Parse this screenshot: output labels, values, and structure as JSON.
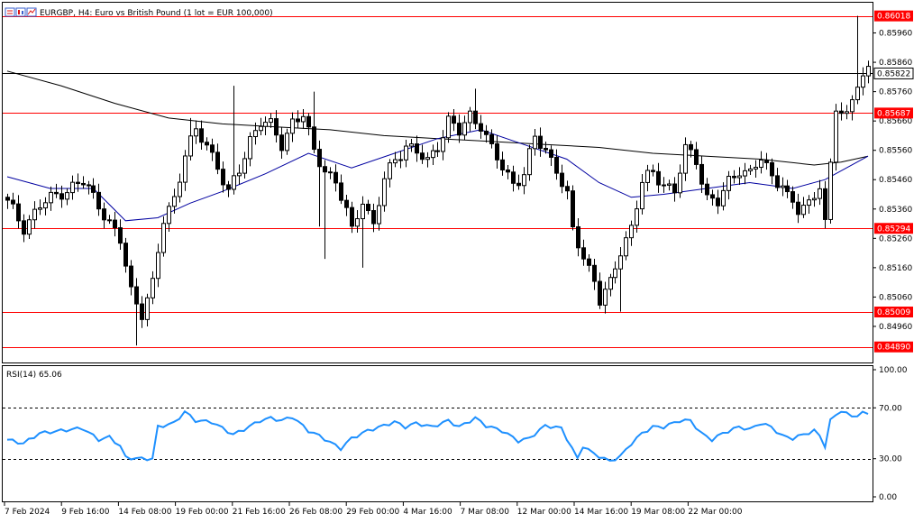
{
  "header": {
    "symbol_info": "EURGBP, H4:  Euro vs British Pound (1 lot = EUR 100,000)"
  },
  "rsi_panel": {
    "label": "RSI(14) 65.06"
  },
  "colors": {
    "background": "#ffffff",
    "candle": "#000000",
    "level_line": "#ff0000",
    "level_tag_bg": "#ff0000",
    "level_tag_text": "#ffffff",
    "current_price_line": "#000000",
    "ma_slow": "#000000",
    "ma_fast": "#0000a0",
    "rsi_line": "#1e90ff",
    "grid_dash": "#000000"
  },
  "icons": [
    "chart-bars-icon",
    "chart-candles-icon",
    "chart-line-icon"
  ],
  "chart_data": [
    {
      "type": "candlestick",
      "title": "EURGBP, H4:  Euro vs British Pound (1 lot = EUR 100,000)",
      "ylim": [
        0.8484,
        0.8606
      ],
      "y_ticks": [
        "0.85960",
        "0.85860",
        "0.85760",
        "0.85660",
        "0.85560",
        "0.85460",
        "0.85360",
        "0.85260",
        "0.85160",
        "0.85060",
        "0.84960"
      ],
      "x_ticks": [
        "7 Feb 2024",
        "9 Feb 16:00",
        "14 Feb 08:00",
        "19 Feb 00:00",
        "21 Feb 16:00",
        "26 Feb 08:00",
        "29 Feb 00:00",
        "4 Mar 16:00",
        "7 Mar 08:00",
        "12 Mar 00:00",
        "14 Mar 16:00",
        "19 Mar 08:00",
        "22 Mar 00:00"
      ],
      "levels": [
        {
          "value": 0.86018,
          "label": "0.86018"
        },
        {
          "value": 0.85687,
          "label": "0.85687"
        },
        {
          "value": 0.85294,
          "label": "0.85294"
        },
        {
          "value": 0.85009,
          "label": "0.85009"
        },
        {
          "value": 0.8489,
          "label": "0.84890"
        }
      ],
      "current_price": {
        "value": 0.85822,
        "label": "0.85822"
      },
      "trend": [
        {
          "i": 0,
          "p": 0.8538
        },
        {
          "i": 3,
          "p": 0.853
        },
        {
          "i": 6,
          "p": 0.8537
        },
        {
          "i": 10,
          "p": 0.8542
        },
        {
          "i": 14,
          "p": 0.8545
        },
        {
          "i": 17,
          "p": 0.8538
        },
        {
          "i": 19,
          "p": 0.8531
        },
        {
          "i": 21,
          "p": 0.8525
        },
        {
          "i": 23,
          "p": 0.8508
        },
        {
          "i": 25,
          "p": 0.8501
        },
        {
          "i": 27,
          "p": 0.851
        },
        {
          "i": 29,
          "p": 0.8532
        },
        {
          "i": 31,
          "p": 0.854
        },
        {
          "i": 33,
          "p": 0.8555
        },
        {
          "i": 35,
          "p": 0.8562
        },
        {
          "i": 37,
          "p": 0.8558
        },
        {
          "i": 39,
          "p": 0.8551
        },
        {
          "i": 41,
          "p": 0.8541
        },
        {
          "i": 43,
          "p": 0.8549
        },
        {
          "i": 45,
          "p": 0.856
        },
        {
          "i": 47,
          "p": 0.8566
        },
        {
          "i": 49,
          "p": 0.8564
        },
        {
          "i": 51,
          "p": 0.8558
        },
        {
          "i": 53,
          "p": 0.8566
        },
        {
          "i": 55,
          "p": 0.8568
        },
        {
          "i": 57,
          "p": 0.8555
        },
        {
          "i": 59,
          "p": 0.855
        },
        {
          "i": 61,
          "p": 0.8545
        },
        {
          "i": 63,
          "p": 0.8535
        },
        {
          "i": 64,
          "p": 0.8528
        },
        {
          "i": 66,
          "p": 0.854
        },
        {
          "i": 68,
          "p": 0.853
        },
        {
          "i": 70,
          "p": 0.8546
        },
        {
          "i": 72,
          "p": 0.8553
        },
        {
          "i": 74,
          "p": 0.8558
        },
        {
          "i": 76,
          "p": 0.8555
        },
        {
          "i": 78,
          "p": 0.8552
        },
        {
          "i": 80,
          "p": 0.8558
        },
        {
          "i": 82,
          "p": 0.8566
        },
        {
          "i": 84,
          "p": 0.8562
        },
        {
          "i": 86,
          "p": 0.8568
        },
        {
          "i": 88,
          "p": 0.8565
        },
        {
          "i": 90,
          "p": 0.8556
        },
        {
          "i": 92,
          "p": 0.855
        },
        {
          "i": 94,
          "p": 0.8545
        },
        {
          "i": 96,
          "p": 0.8548
        },
        {
          "i": 98,
          "p": 0.856
        },
        {
          "i": 100,
          "p": 0.8556
        },
        {
          "i": 102,
          "p": 0.855
        },
        {
          "i": 104,
          "p": 0.854
        },
        {
          "i": 105,
          "p": 0.8528
        },
        {
          "i": 107,
          "p": 0.852
        },
        {
          "i": 109,
          "p": 0.8512
        },
        {
          "i": 110,
          "p": 0.8505
        },
        {
          "i": 112,
          "p": 0.851
        },
        {
          "i": 114,
          "p": 0.8522
        },
        {
          "i": 116,
          "p": 0.853
        },
        {
          "i": 118,
          "p": 0.8545
        },
        {
          "i": 120,
          "p": 0.8548
        },
        {
          "i": 122,
          "p": 0.8545
        },
        {
          "i": 124,
          "p": 0.8542
        },
        {
          "i": 126,
          "p": 0.8556
        },
        {
          "i": 128,
          "p": 0.8553
        },
        {
          "i": 130,
          "p": 0.854
        },
        {
          "i": 132,
          "p": 0.8538
        },
        {
          "i": 134,
          "p": 0.8545
        },
        {
          "i": 136,
          "p": 0.855
        },
        {
          "i": 138,
          "p": 0.8548
        },
        {
          "i": 140,
          "p": 0.8553
        },
        {
          "i": 142,
          "p": 0.8547
        },
        {
          "i": 144,
          "p": 0.8545
        },
        {
          "i": 145,
          "p": 0.854
        },
        {
          "i": 147,
          "p": 0.8535
        },
        {
          "i": 149,
          "p": 0.8538
        },
        {
          "i": 151,
          "p": 0.8545
        },
        {
          "i": 152,
          "p": 0.8531
        },
        {
          "i": 153,
          "p": 0.855
        },
        {
          "i": 154,
          "p": 0.857
        },
        {
          "i": 156,
          "p": 0.8568
        },
        {
          "i": 158,
          "p": 0.858
        },
        {
          "i": 160,
          "p": 0.8582
        }
      ],
      "spikes": [
        {
          "i": 24,
          "p": 0.84895
        },
        {
          "i": 34,
          "p": 0.8567
        },
        {
          "i": 42,
          "p": 0.8578
        },
        {
          "i": 57,
          "p": 0.8576
        },
        {
          "i": 58,
          "p": 0.853
        },
        {
          "i": 59,
          "p": 0.8519
        },
        {
          "i": 66,
          "p": 0.8516
        },
        {
          "i": 87,
          "p": 0.8577
        },
        {
          "i": 114,
          "p": 0.8501
        },
        {
          "i": 152,
          "p": 0.85294
        },
        {
          "i": 158,
          "p": 0.86018
        }
      ],
      "ma_slow": [
        {
          "i": 0,
          "p": 0.8583
        },
        {
          "i": 10,
          "p": 0.8578
        },
        {
          "i": 20,
          "p": 0.8572
        },
        {
          "i": 30,
          "p": 0.8567
        },
        {
          "i": 40,
          "p": 0.8565
        },
        {
          "i": 50,
          "p": 0.8564
        },
        {
          "i": 60,
          "p": 0.8563
        },
        {
          "i": 70,
          "p": 0.8561
        },
        {
          "i": 80,
          "p": 0.856
        },
        {
          "i": 90,
          "p": 0.8559
        },
        {
          "i": 100,
          "p": 0.8558
        },
        {
          "i": 110,
          "p": 0.8557
        },
        {
          "i": 120,
          "p": 0.8555
        },
        {
          "i": 130,
          "p": 0.8554
        },
        {
          "i": 140,
          "p": 0.8553
        },
        {
          "i": 150,
          "p": 0.8551
        },
        {
          "i": 155,
          "p": 0.8552
        },
        {
          "i": 160,
          "p": 0.8554
        }
      ],
      "ma_fast": [
        {
          "i": 0,
          "p": 0.8547
        },
        {
          "i": 8,
          "p": 0.8543
        },
        {
          "i": 16,
          "p": 0.8543
        },
        {
          "i": 22,
          "p": 0.8532
        },
        {
          "i": 28,
          "p": 0.8533
        },
        {
          "i": 34,
          "p": 0.8538
        },
        {
          "i": 40,
          "p": 0.8542
        },
        {
          "i": 48,
          "p": 0.8548
        },
        {
          "i": 56,
          "p": 0.8555
        },
        {
          "i": 64,
          "p": 0.855
        },
        {
          "i": 72,
          "p": 0.8555
        },
        {
          "i": 80,
          "p": 0.856
        },
        {
          "i": 88,
          "p": 0.8563
        },
        {
          "i": 96,
          "p": 0.8558
        },
        {
          "i": 104,
          "p": 0.8553
        },
        {
          "i": 110,
          "p": 0.8545
        },
        {
          "i": 116,
          "p": 0.854
        },
        {
          "i": 122,
          "p": 0.8541
        },
        {
          "i": 130,
          "p": 0.8543
        },
        {
          "i": 138,
          "p": 0.8545
        },
        {
          "i": 146,
          "p": 0.8543
        },
        {
          "i": 152,
          "p": 0.8546
        },
        {
          "i": 156,
          "p": 0.855
        },
        {
          "i": 160,
          "p": 0.8554
        }
      ]
    },
    {
      "type": "line",
      "title": "RSI(14) 65.06",
      "ylim": [
        0,
        100
      ],
      "y_ticks": [
        "100.00",
        "70.00",
        "30.00",
        "0.00"
      ],
      "dashed_levels": [
        70,
        30
      ],
      "series": [
        {
          "values": [
            {
              "i": 0,
              "v": 45
            },
            {
              "i": 3,
              "v": 42
            },
            {
              "i": 6,
              "v": 50
            },
            {
              "i": 10,
              "v": 52
            },
            {
              "i": 14,
              "v": 54
            },
            {
              "i": 17,
              "v": 45
            },
            {
              "i": 19,
              "v": 47
            },
            {
              "i": 21,
              "v": 40
            },
            {
              "i": 22,
              "v": 31
            },
            {
              "i": 25,
              "v": 30
            },
            {
              "i": 27,
              "v": 30
            },
            {
              "i": 28,
              "v": 55
            },
            {
              "i": 31,
              "v": 58
            },
            {
              "i": 33,
              "v": 67
            },
            {
              "i": 35,
              "v": 60
            },
            {
              "i": 38,
              "v": 59
            },
            {
              "i": 42,
              "v": 49
            },
            {
              "i": 44,
              "v": 53
            },
            {
              "i": 47,
              "v": 60
            },
            {
              "i": 49,
              "v": 62
            },
            {
              "i": 51,
              "v": 60
            },
            {
              "i": 53,
              "v": 63
            },
            {
              "i": 56,
              "v": 52
            },
            {
              "i": 58,
              "v": 48
            },
            {
              "i": 60,
              "v": 43
            },
            {
              "i": 62,
              "v": 38
            },
            {
              "i": 64,
              "v": 46
            },
            {
              "i": 67,
              "v": 52
            },
            {
              "i": 70,
              "v": 56
            },
            {
              "i": 72,
              "v": 59
            },
            {
              "i": 74,
              "v": 55
            },
            {
              "i": 76,
              "v": 58
            },
            {
              "i": 79,
              "v": 55
            },
            {
              "i": 82,
              "v": 60
            },
            {
              "i": 84,
              "v": 55
            },
            {
              "i": 87,
              "v": 62
            },
            {
              "i": 89,
              "v": 56
            },
            {
              "i": 92,
              "v": 52
            },
            {
              "i": 95,
              "v": 44
            },
            {
              "i": 97,
              "v": 46
            },
            {
              "i": 100,
              "v": 56
            },
            {
              "i": 103,
              "v": 54
            },
            {
              "i": 105,
              "v": 38
            },
            {
              "i": 106,
              "v": 30
            },
            {
              "i": 107,
              "v": 40
            },
            {
              "i": 109,
              "v": 34
            },
            {
              "i": 111,
              "v": 30
            },
            {
              "i": 112,
              "v": 28
            },
            {
              "i": 114,
              "v": 32
            },
            {
              "i": 116,
              "v": 42
            },
            {
              "i": 118,
              "v": 50
            },
            {
              "i": 120,
              "v": 55
            },
            {
              "i": 122,
              "v": 55
            },
            {
              "i": 125,
              "v": 60
            },
            {
              "i": 127,
              "v": 60
            },
            {
              "i": 129,
              "v": 50
            },
            {
              "i": 131,
              "v": 45
            },
            {
              "i": 133,
              "v": 50
            },
            {
              "i": 136,
              "v": 55
            },
            {
              "i": 138,
              "v": 53
            },
            {
              "i": 140,
              "v": 58
            },
            {
              "i": 142,
              "v": 55
            },
            {
              "i": 144,
              "v": 48
            },
            {
              "i": 146,
              "v": 46
            },
            {
              "i": 148,
              "v": 49
            },
            {
              "i": 150,
              "v": 52
            },
            {
              "i": 151,
              "v": 48
            },
            {
              "i": 152,
              "v": 40
            },
            {
              "i": 153,
              "v": 60
            },
            {
              "i": 155,
              "v": 68
            },
            {
              "i": 157,
              "v": 63
            },
            {
              "i": 159,
              "v": 66
            },
            {
              "i": 160,
              "v": 65
            }
          ]
        }
      ]
    }
  ]
}
